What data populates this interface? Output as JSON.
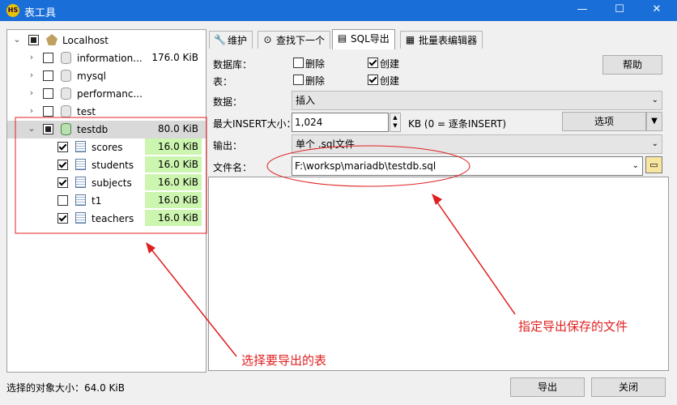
{
  "window": {
    "title": "表工具",
    "app_icon": "HS",
    "minimize": "—",
    "maximize": "☐",
    "close": "✕"
  },
  "tree": {
    "root": {
      "label": "Localhost"
    },
    "databases": [
      {
        "name": "information...",
        "size": "176.0 KiB"
      },
      {
        "name": "mysql",
        "size": ""
      },
      {
        "name": "performanc...",
        "size": ""
      },
      {
        "name": "test",
        "size": ""
      },
      {
        "name": "testdb",
        "size": "80.0 KiB"
      }
    ],
    "tables": [
      {
        "name": "scores",
        "size": "16.0 KiB",
        "checked": true
      },
      {
        "name": "students",
        "size": "16.0 KiB",
        "checked": true
      },
      {
        "name": "subjects",
        "size": "16.0 KiB",
        "checked": true
      },
      {
        "name": "t1",
        "size": "16.0 KiB",
        "checked": false
      },
      {
        "name": "teachers",
        "size": "16.0 KiB",
        "checked": true
      }
    ]
  },
  "tabs": [
    {
      "label": "维护"
    },
    {
      "label": "查找下一个"
    },
    {
      "label": "SQL导出"
    },
    {
      "label": "批量表编辑器"
    }
  ],
  "form": {
    "database_label": "数据库：",
    "table_label": "表：",
    "drop_label": "删除",
    "create_label": "创建",
    "help_button": "帮助",
    "data_label": "数据：",
    "data_value": "插入",
    "max_insert_label": "最大INSERT大小：",
    "max_insert_value": "1,024",
    "max_insert_hint": "KB (0 = 逐条INSERT)",
    "options_button": "选项",
    "output_label": "输出：",
    "output_value": "单个 .sql文件",
    "filename_label": "文件名：",
    "filename_value": "F:\\worksp\\mariadb\\testdb.sql"
  },
  "annotations": {
    "tables_note": "选择要导出的表",
    "file_note": "指定导出保存的文件"
  },
  "colors": {
    "annotation": "#e02020",
    "size_highlight": "#ccf5b0",
    "titlebar": "#1a6ed8"
  },
  "status": {
    "selected_size": "选择的对象大小：64.0 KiB"
  },
  "buttons": {
    "export": "导出",
    "close": "关闭"
  }
}
